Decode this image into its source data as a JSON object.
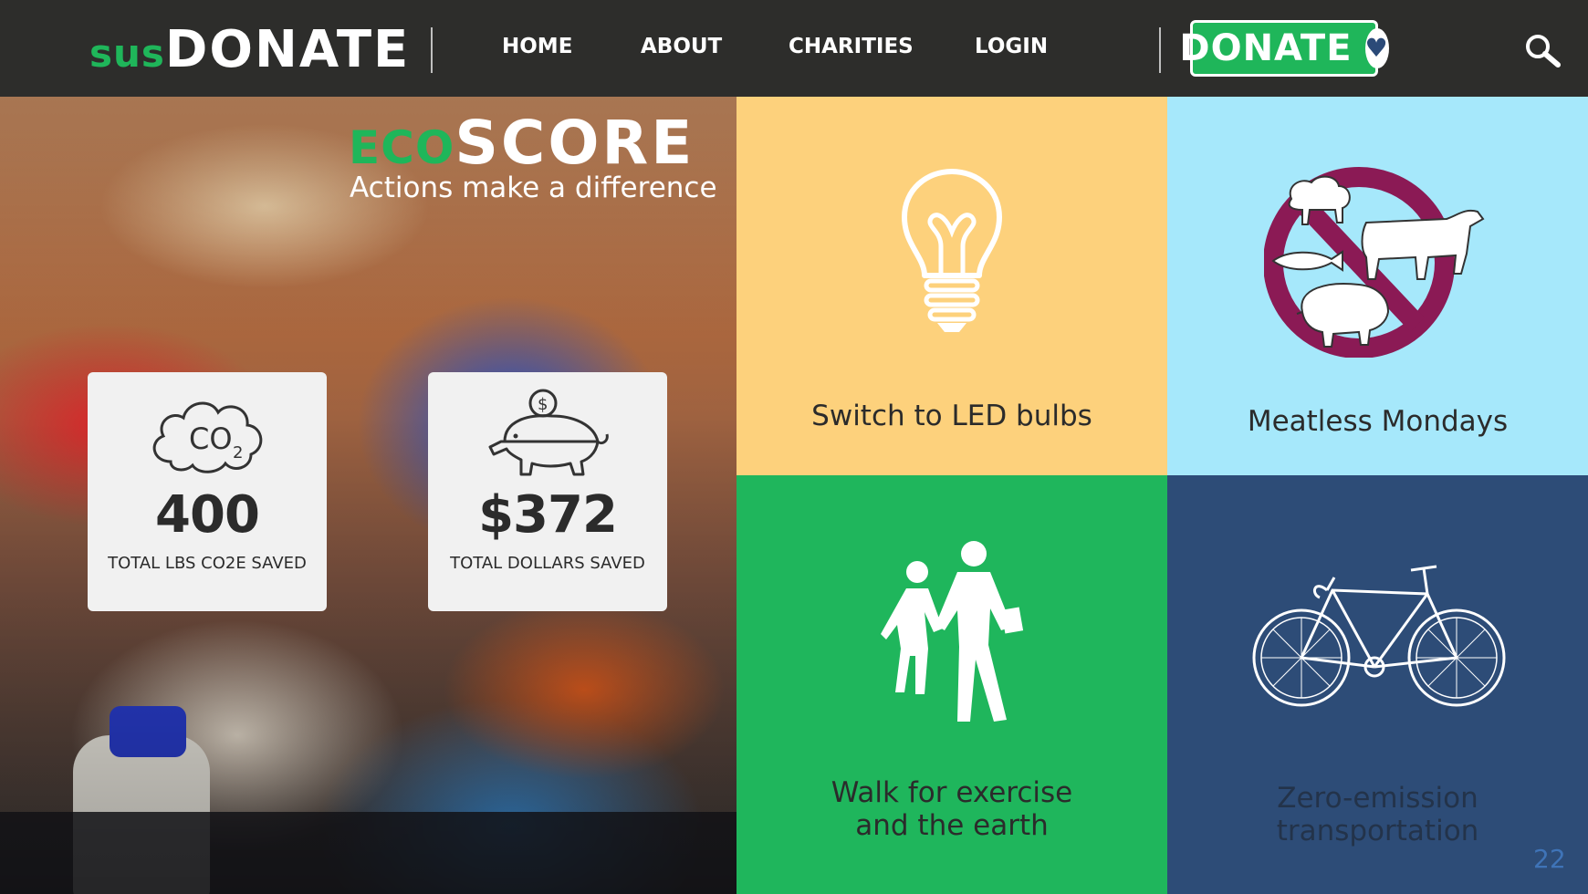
{
  "header": {
    "logo_sus": "sus",
    "logo_donate": "DONATE",
    "nav": [
      {
        "label": "HOME"
      },
      {
        "label": "ABOUT"
      },
      {
        "label": "CHARITIES"
      },
      {
        "label": "LOGIN"
      }
    ],
    "donate_button": "DONATE",
    "donate_icon": "heart-icon",
    "search_icon": "search-icon"
  },
  "hero": {
    "eco": "ECO",
    "score": "SCORE",
    "tagline": "Actions make a difference",
    "stats": [
      {
        "icon": "co2-cloud-icon",
        "icon_text": "CO",
        "icon_sub": "2",
        "value": "400",
        "label": "TOTAL LBS CO2E SAVED"
      },
      {
        "icon": "piggy-bank-icon",
        "icon_text": "$",
        "value": "$372",
        "label": "TOTAL DOLLARS SAVED"
      }
    ]
  },
  "tiles": [
    {
      "label": "Switch to LED bulbs",
      "icon": "lightbulb-icon"
    },
    {
      "label": "Meatless Mondays",
      "icon": "no-meat-icon"
    },
    {
      "label_line1": "Walk for exercise",
      "label_line2": "and the earth",
      "icon": "walking-people-icon"
    },
    {
      "label_line1": "Zero-emission",
      "label_line2": "transportation",
      "icon": "bicycle-icon"
    }
  ],
  "page_number": "22",
  "colors": {
    "brand_green": "#1fb65a",
    "header_bg": "#2d2d2b",
    "tile_yellow": "#fdd17c",
    "tile_blue": "#a6e8fb",
    "tile_green": "#1fb65c",
    "tile_navy": "#2d4c77",
    "no_sign": "#8b1a55"
  }
}
